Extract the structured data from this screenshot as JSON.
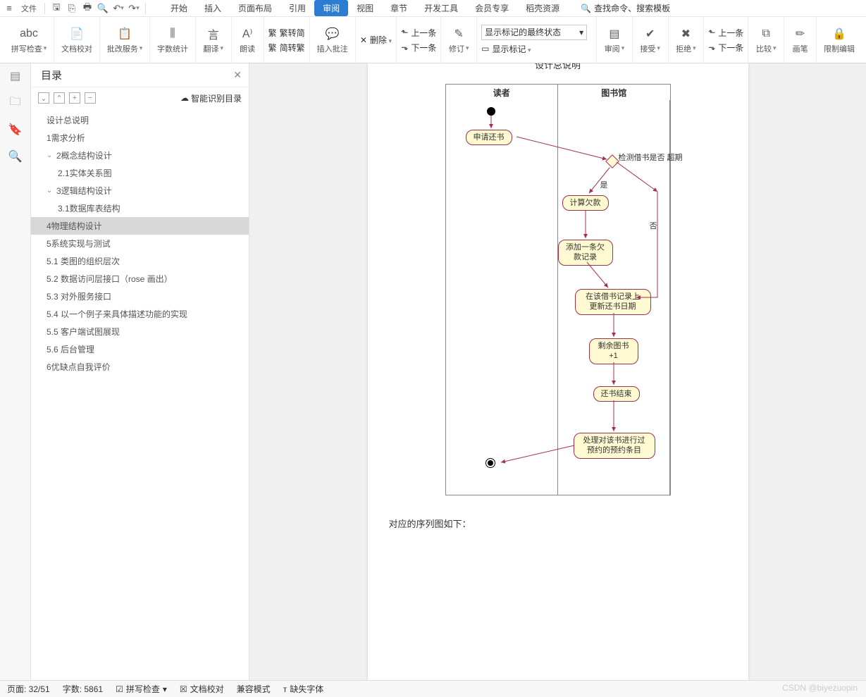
{
  "menubar": {
    "file": "文件"
  },
  "tabs": [
    "开始",
    "插入",
    "页面布局",
    "引用",
    "审阅",
    "视图",
    "章节",
    "开发工具",
    "会员专享",
    "稻壳资源"
  ],
  "activeTab": 4,
  "searchPlaceholder": "查找命令、搜索模板",
  "ribbon": {
    "spellcheck": "拼写检查",
    "proofread": "文档校对",
    "approval": "批改服务",
    "wordcount": "字数统计",
    "translate": "翻译",
    "read": "朗读",
    "trad2simp": "繁转简",
    "simp2trad": "简转繁",
    "insertComment": "插入批注",
    "delete": "删除",
    "prev": "上一条",
    "next": "下一条",
    "revise": "修订",
    "showMarkup": "显示标记",
    "markupCombo": "显示标记的最终状态",
    "reviewPane": "审阅",
    "accept": "接受",
    "reject": "拒绝",
    "upItem": "上一条",
    "downItem": "下一条",
    "compare": "比较",
    "ink": "画笔",
    "restrict": "限制编辑"
  },
  "toc": {
    "title": "目录",
    "smart": "智能识别目录",
    "items": [
      {
        "t": "设计总说明",
        "lv": 1
      },
      {
        "t": "1需求分析",
        "lv": 1
      },
      {
        "t": "2概念结构设计",
        "lv": 1,
        "caret": true
      },
      {
        "t": "2.1实体关系图",
        "lv": 2
      },
      {
        "t": "3逻辑结构设计",
        "lv": 1,
        "caret": true
      },
      {
        "t": "3.1数据库表结构",
        "lv": 2
      },
      {
        "t": "4物理结构设计",
        "lv": 1,
        "selected": true
      },
      {
        "t": "5系统实现与测试",
        "lv": 1
      },
      {
        "t": "5.1  类图的组织层次",
        "lv": 1
      },
      {
        "t": "5.2  数据访问层接口（rose 画出）",
        "lv": 1
      },
      {
        "t": "5.3  对外服务接口",
        "lv": 1
      },
      {
        "t": "5.4  以一个例子来具体描述功能的实现",
        "lv": 1
      },
      {
        "t": "5.5  客户端试图展现",
        "lv": 1
      },
      {
        "t": "5.6  后台管理",
        "lv": 1
      },
      {
        "t": "6优缺点自我评价",
        "lv": 1
      }
    ]
  },
  "doc": {
    "titleCut": "设计总说明",
    "swim": {
      "col1": "读者",
      "col2": "图书馆"
    },
    "nodes": {
      "apply": "申请还书",
      "check": "检测借书是否\n超期",
      "yes": "是",
      "no": "否",
      "calc": "计算欠款",
      "addrec": "添加一条欠\n款记录",
      "update": "在该借书记录上\n更新还书日期",
      "remain": "剩余图书\n+1",
      "end": "还书结束",
      "reserve": "处理对该书进行过\n预约的预约条目"
    },
    "caption": "对应的序列图如下："
  },
  "status": {
    "page": "页面: 32/51",
    "words": "字数: 5861",
    "spell": "拼写检查",
    "proof": "文档校对",
    "compat": "兼容模式",
    "missfont": "缺失字体"
  },
  "watermark": "CSDN @biyezuopin"
}
